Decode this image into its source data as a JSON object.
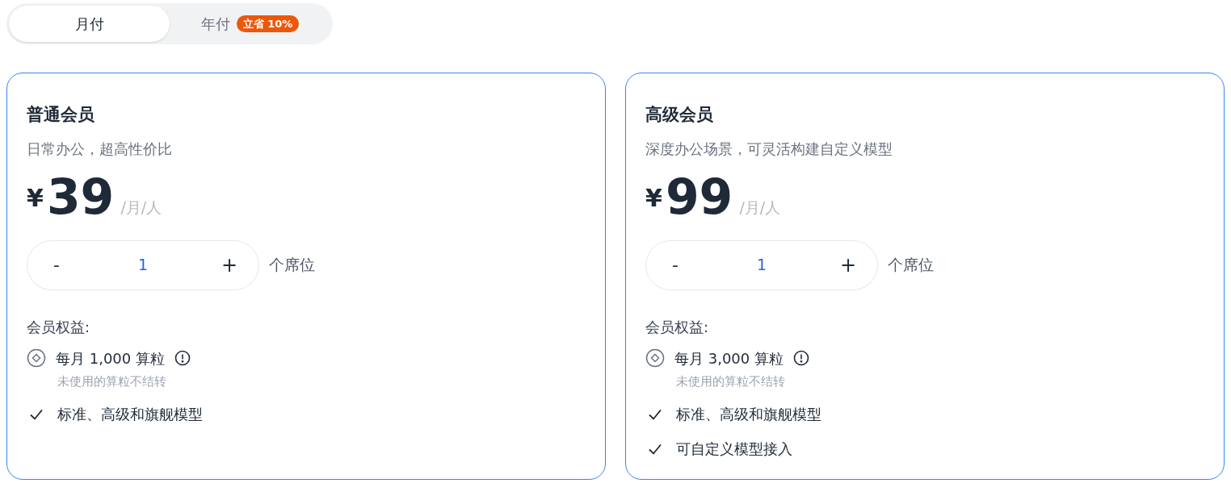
{
  "billing_tabs": [
    {
      "label": "月付",
      "selected": true
    },
    {
      "label": "年付",
      "selected": false,
      "badge": "立省 10%"
    }
  ],
  "plans": [
    {
      "title": "普通会员",
      "subtitle": "日常办公，超高性价比",
      "currency": "¥",
      "price": "39",
      "unit": "/月/人",
      "stepper": {
        "minus": "-",
        "value": "1",
        "plus": "+"
      },
      "seat_label": "个席位",
      "benefits_title": "会员权益:",
      "benefits": [
        {
          "kind": "credits",
          "text": "每月 1,000 算粒",
          "note": "未使用的算粒不结转"
        },
        {
          "kind": "check",
          "text": "标准、高级和旗舰模型"
        }
      ]
    },
    {
      "title": "高级会员",
      "subtitle": "深度办公场景，可灵活构建自定义模型",
      "currency": "¥",
      "price": "99",
      "unit": "/月/人",
      "stepper": {
        "minus": "-",
        "value": "1",
        "plus": "+"
      },
      "seat_label": "个席位",
      "benefits_title": "会员权益:",
      "benefits": [
        {
          "kind": "credits",
          "text": "每月 3,000 算粒",
          "note": "未使用的算粒不结转"
        },
        {
          "kind": "check",
          "text": "标准、高级和旗舰模型"
        },
        {
          "kind": "check",
          "text": "可自定义模型接入"
        }
      ]
    }
  ]
}
